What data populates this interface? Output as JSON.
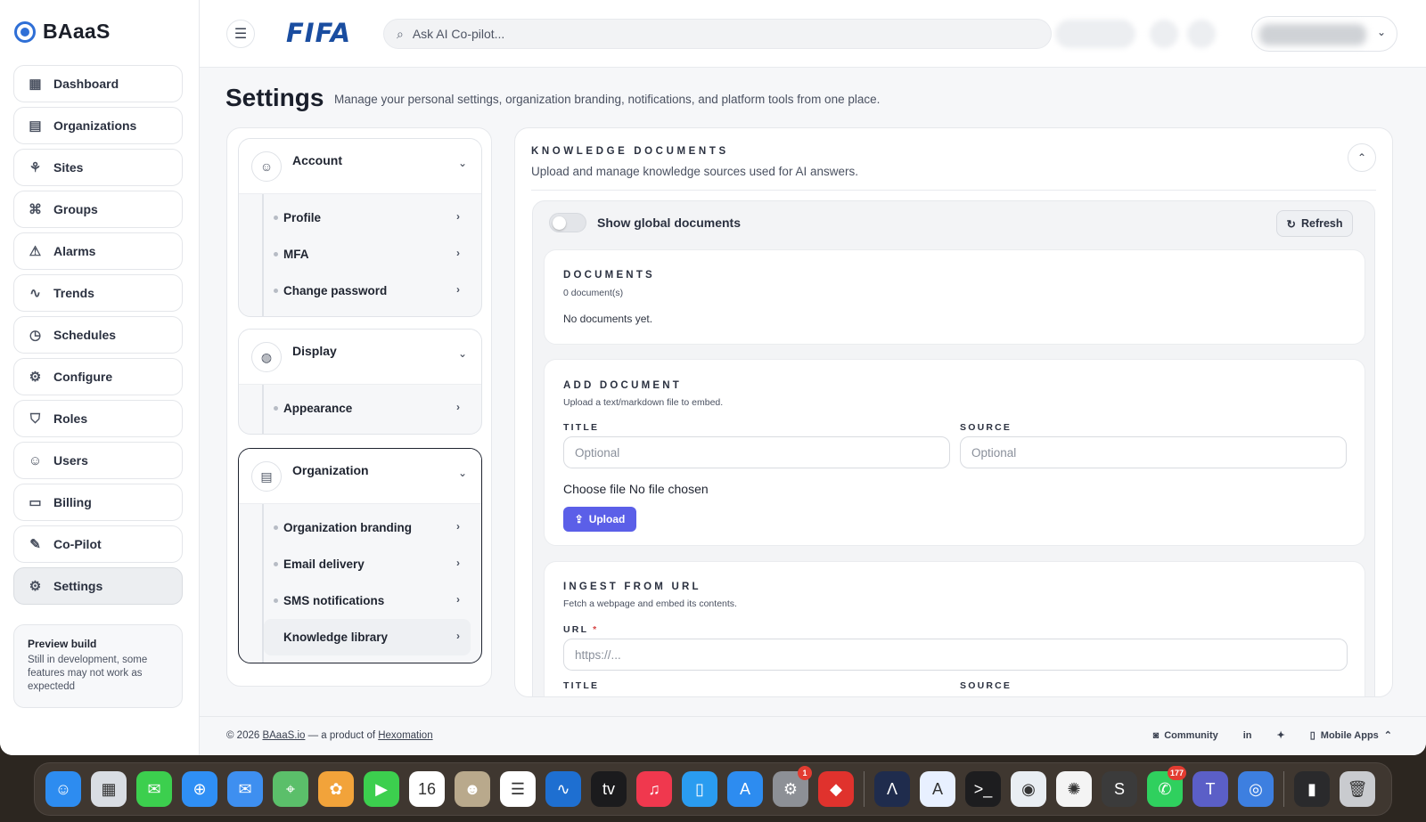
{
  "brand": {
    "name": "BAaaS"
  },
  "sidebar": {
    "items": [
      {
        "label": "Dashboard",
        "icon": "dashboard-icon"
      },
      {
        "label": "Organizations",
        "icon": "building-icon"
      },
      {
        "label": "Sites",
        "icon": "sites-icon"
      },
      {
        "label": "Groups",
        "icon": "groups-icon"
      },
      {
        "label": "Alarms",
        "icon": "alarm-icon"
      },
      {
        "label": "Trends",
        "icon": "trend-icon"
      },
      {
        "label": "Schedules",
        "icon": "clock-icon"
      },
      {
        "label": "Configure",
        "icon": "gear-icon"
      },
      {
        "label": "Roles",
        "icon": "shield-icon"
      },
      {
        "label": "Users",
        "icon": "users-icon"
      },
      {
        "label": "Billing",
        "icon": "billing-icon"
      },
      {
        "label": "Co-Pilot",
        "icon": "copilot-icon"
      },
      {
        "label": "Settings",
        "icon": "settings-icon"
      }
    ],
    "active": "Settings",
    "preview": {
      "title": "Preview build",
      "desc": "Still in development, some features may not work as expectedd"
    }
  },
  "topbar": {
    "logo": "FIFA",
    "search_placeholder": "Ask AI Co-pilot..."
  },
  "header": {
    "title": "Settings",
    "desc": "Manage your personal settings, organization branding, notifications, and platform tools from one place."
  },
  "settings_nav": {
    "account": {
      "title": "Account",
      "items": [
        "Profile",
        "MFA",
        "Change password"
      ]
    },
    "display": {
      "title": "Display",
      "items": [
        "Appearance"
      ]
    },
    "organization": {
      "title": "Organization",
      "items": [
        "Organization branding",
        "Email delivery",
        "SMS notifications",
        "Knowledge library"
      ],
      "active": "Knowledge library"
    }
  },
  "knowledge": {
    "title": "KNOWLEDGE DOCUMENTS",
    "subtitle": "Upload and manage knowledge sources used for AI answers.",
    "toggle_label": "Show global documents",
    "toggle_on": false,
    "refresh_label": "Refresh",
    "documents": {
      "title": "DOCUMENTS",
      "count": "0 document(s)",
      "empty": "No documents yet."
    },
    "add": {
      "title": "ADD DOCUMENT",
      "subtitle": "Upload a text/markdown file to embed.",
      "title_label": "TITLE",
      "title_placeholder": "Optional",
      "source_label": "SOURCE",
      "source_placeholder": "Optional",
      "file_text": "Choose file  No file chosen",
      "upload_label": "Upload"
    },
    "ingest": {
      "title": "INGEST FROM URL",
      "subtitle": "Fetch a webpage and embed its contents.",
      "url_label": "URL",
      "url_required": "*",
      "url_placeholder": "https://...",
      "title_label": "TITLE",
      "source_label": "SOURCE"
    }
  },
  "footer": {
    "copy_prefix": "© 2026 ",
    "site": "BAaaS.io",
    "middle": " — a product of ",
    "company": "Hexomation",
    "community": "Community",
    "mobile": "Mobile Apps"
  },
  "dock": {
    "apps": [
      {
        "name": "finder",
        "glyph": "☺",
        "color": "#2d8cf0"
      },
      {
        "name": "launchpad",
        "glyph": "▦",
        "color": "#d9dde3"
      },
      {
        "name": "messages",
        "glyph": "✉",
        "color": "#3ccf4e"
      },
      {
        "name": "safari",
        "glyph": "⊕",
        "color": "#2f8ff5"
      },
      {
        "name": "mail",
        "glyph": "✉",
        "color": "#3e8ff0"
      },
      {
        "name": "maps",
        "glyph": "⌖",
        "color": "#5bbf6a"
      },
      {
        "name": "photos",
        "glyph": "✿",
        "color": "#f2a33a"
      },
      {
        "name": "facetime",
        "glyph": "▶",
        "color": "#3ccf4e"
      },
      {
        "name": "calendar",
        "glyph": "16",
        "color": "#ffffff"
      },
      {
        "name": "contacts",
        "glyph": "☻",
        "color": "#b9a98c"
      },
      {
        "name": "reminders",
        "glyph": "☰",
        "color": "#ffffff"
      },
      {
        "name": "freeform",
        "glyph": "∿",
        "color": "#1e6fd1"
      },
      {
        "name": "tv",
        "glyph": "tv",
        "color": "#1b1b1d"
      },
      {
        "name": "music",
        "glyph": "♫",
        "color": "#f0384e"
      },
      {
        "name": "keynote",
        "glyph": "▯",
        "color": "#2a9cf0"
      },
      {
        "name": "app-store",
        "glyph": "A",
        "color": "#2d8cf0"
      },
      {
        "name": "system-settings",
        "glyph": "⚙",
        "color": "#8d9096",
        "badge": "1"
      },
      {
        "name": "pdf-app",
        "glyph": "◆",
        "color": "#e0322d"
      },
      {
        "name": "arc",
        "glyph": "Λ",
        "color": "#1f2c4d"
      },
      {
        "name": "xcode-tools",
        "glyph": "A",
        "color": "#e8f0ff"
      },
      {
        "name": "terminal",
        "glyph": ">_",
        "color": "#1d1d1f"
      },
      {
        "name": "chrome",
        "glyph": "◉",
        "color": "#e9eef3"
      },
      {
        "name": "chatgpt",
        "glyph": "✺",
        "color": "#f4f4f4"
      },
      {
        "name": "sublime",
        "glyph": "S",
        "color": "#3b3b3b"
      },
      {
        "name": "whatsapp",
        "glyph": "✆",
        "color": "#2fd05e",
        "badge": "177"
      },
      {
        "name": "teams",
        "glyph": "T",
        "color": "#5b5fc7"
      },
      {
        "name": "silhouette",
        "glyph": "◎",
        "color": "#3d7fe0"
      },
      {
        "name": "downloads",
        "glyph": "▮",
        "color": "#2a2a2c"
      },
      {
        "name": "trash",
        "glyph": "🗑",
        "color": "#c9cbcf"
      }
    ]
  }
}
